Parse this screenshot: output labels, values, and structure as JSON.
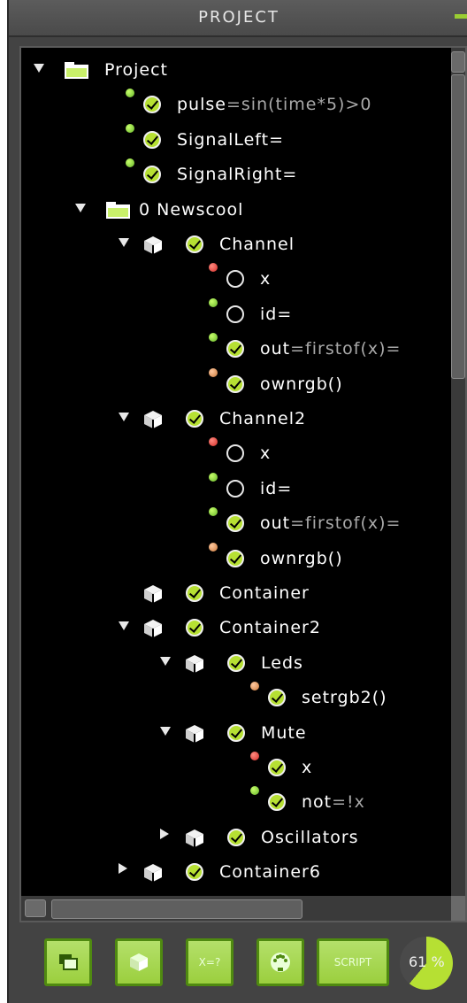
{
  "header": {
    "title": "PROJECT"
  },
  "tree": {
    "rows": [
      {
        "type": "folder",
        "expanded": true,
        "label": "Project"
      },
      {
        "type": "signal",
        "dot": "green",
        "checked": true,
        "label": "pulse",
        "expr": "=sin(time*5)>0"
      },
      {
        "type": "signal",
        "dot": "green",
        "checked": true,
        "label": "SignalLeft=",
        "expr": ""
      },
      {
        "type": "signal",
        "dot": "green",
        "checked": true,
        "label": "SignalRight=",
        "expr": ""
      },
      {
        "type": "folder",
        "expanded": true,
        "label": "0 Newscool"
      },
      {
        "type": "module",
        "expanded": true,
        "checked": true,
        "label": "Channel"
      },
      {
        "type": "signal",
        "dot": "red",
        "checked": false,
        "label": "x",
        "expr": ""
      },
      {
        "type": "signal",
        "dot": "green",
        "checked": false,
        "label": "id=",
        "expr": ""
      },
      {
        "type": "signal",
        "dot": "green",
        "checked": true,
        "label": "out",
        "expr": "=firstof(x)="
      },
      {
        "type": "signal",
        "dot": "orange",
        "checked": true,
        "label": "ownrgb()",
        "expr": ""
      },
      {
        "type": "module",
        "expanded": true,
        "checked": true,
        "label": "Channel2"
      },
      {
        "type": "signal",
        "dot": "red",
        "checked": false,
        "label": "x",
        "expr": ""
      },
      {
        "type": "signal",
        "dot": "green",
        "checked": false,
        "label": "id=",
        "expr": ""
      },
      {
        "type": "signal",
        "dot": "green",
        "checked": true,
        "label": "out",
        "expr": "=firstof(x)="
      },
      {
        "type": "signal",
        "dot": "orange",
        "checked": true,
        "label": "ownrgb()",
        "expr": ""
      },
      {
        "type": "module",
        "expanded": null,
        "checked": true,
        "label": "Container"
      },
      {
        "type": "module",
        "expanded": true,
        "checked": true,
        "label": "Container2"
      },
      {
        "type": "module",
        "expanded": true,
        "checked": true,
        "label": "Leds"
      },
      {
        "type": "signal",
        "dot": "orange",
        "checked": true,
        "label": "setrgb2()",
        "expr": ""
      },
      {
        "type": "module",
        "expanded": true,
        "checked": true,
        "label": "Mute"
      },
      {
        "type": "signal",
        "dot": "red",
        "checked": true,
        "label": "x",
        "expr": ""
      },
      {
        "type": "signal",
        "dot": "green",
        "checked": true,
        "label": "not",
        "expr": "=!x"
      },
      {
        "type": "module",
        "expanded": false,
        "checked": true,
        "label": "Oscillators"
      },
      {
        "type": "module",
        "expanded": false,
        "checked": true,
        "label": "Container6"
      }
    ]
  },
  "toolbar": {
    "buttons": [
      {
        "icon": "windows-icon",
        "label": ""
      },
      {
        "icon": "cube-icon",
        "label": ""
      },
      {
        "icon": "",
        "label": "X=?"
      },
      {
        "icon": "midi-icon",
        "label": ""
      },
      {
        "icon": "",
        "label": "SCRIPT"
      }
    ],
    "progress_percent": 61,
    "progress_text": "61 %"
  },
  "colors": {
    "accent": "#b6e033",
    "dot_green": "#63b32a",
    "dot_red": "#d32d28",
    "dot_orange": "#cc7a3b"
  }
}
